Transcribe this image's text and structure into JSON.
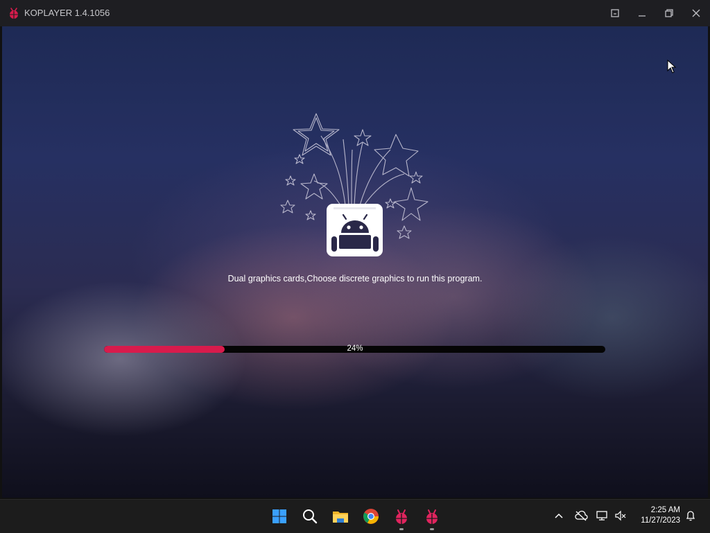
{
  "window": {
    "title": "KOPLAYER 1.4.1056",
    "accent": "#d81b4c"
  },
  "loading": {
    "message": "Dual graphics cards,Choose discrete graphics to run this program.",
    "progress_fraction": 0.24,
    "progress_label": "24%"
  },
  "taskbar": {
    "apps": [
      "windows-start",
      "search",
      "file-explorer",
      "chrome",
      "koplayer",
      "koplayer"
    ],
    "time": "2:25 AM",
    "date": "11/27/2023"
  }
}
